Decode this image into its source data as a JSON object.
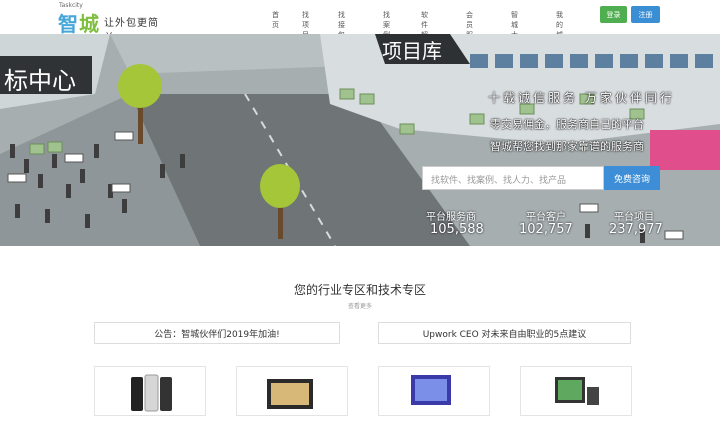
{
  "header": {
    "logo_en": "Taskcity",
    "logo_cn_1": "智",
    "logo_cn_2": "城",
    "slogan": "让外包更简单",
    "nav": [
      "首页",
      "找项目",
      "找接包方",
      "找案例",
      "软件超市",
      "会员服务",
      "智城大学",
      "我的城盘"
    ],
    "login_label": "登录",
    "register_label": "注册"
  },
  "hero": {
    "sign_left": "标中心",
    "sign_center": "项目库",
    "tagline": "十载诚信服务 万家伙伴同行",
    "line2": "零交易佣金，服务商自己的平台",
    "line3": "智城帮您找到那家靠谱的服务商",
    "search_placeholder": "找软件、找案例、找人力、找产品",
    "search_button": "免费咨询",
    "stats": [
      {
        "label": "平台服务商",
        "value": "105,588"
      },
      {
        "label": "平台客户",
        "value": "102,757"
      },
      {
        "label": "平台项目",
        "value": "237,977"
      }
    ]
  },
  "section": {
    "title": "您的行业专区和技术专区",
    "subtitle": "查看更多",
    "notices": [
      "公告：智城伙伴们2019年加油!",
      "Upwork CEO 对未来自由职业的5点建议"
    ]
  },
  "colors": {
    "brand_blue": "#45a6d8",
    "brand_green": "#7fbf3f",
    "login_green": "#4fae4f",
    "button_blue": "#3a8fd4"
  }
}
